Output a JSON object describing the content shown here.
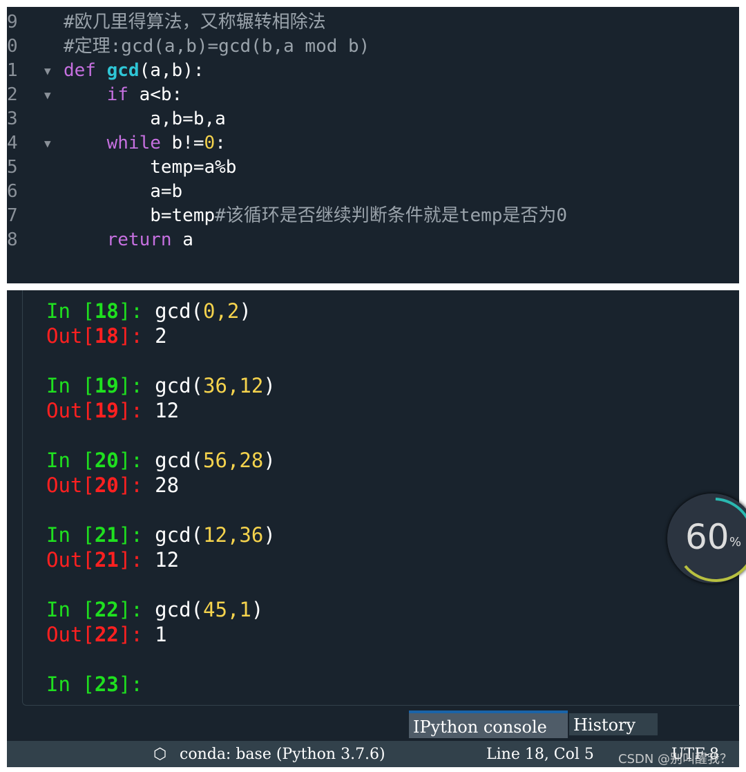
{
  "editor": {
    "lines": [
      {
        "num": "9",
        "fold": false,
        "parts": [
          {
            "t": "#欧几里得算法，又称辗转相除法",
            "c": "cm"
          }
        ]
      },
      {
        "num": "0",
        "fold": false,
        "parts": [
          {
            "t": "#定理:gcd(a,b)=gcd(b,a mod b)",
            "c": "cm"
          }
        ]
      },
      {
        "num": "1",
        "fold": true,
        "parts": [
          {
            "t": "def ",
            "c": "kw"
          },
          {
            "t": "gcd",
            "c": "fn"
          },
          {
            "t": "(a,b):",
            "c": ""
          }
        ]
      },
      {
        "num": "2",
        "fold": true,
        "parts": [
          {
            "t": "    ",
            "c": ""
          },
          {
            "t": "if",
            "c": "kw"
          },
          {
            "t": " a<b:",
            "c": ""
          }
        ]
      },
      {
        "num": "3",
        "fold": false,
        "parts": [
          {
            "t": "        a,b=b,a",
            "c": ""
          }
        ]
      },
      {
        "num": "4",
        "fold": true,
        "parts": [
          {
            "t": "    ",
            "c": ""
          },
          {
            "t": "while",
            "c": "kw"
          },
          {
            "t": " b!=",
            "c": ""
          },
          {
            "t": "0",
            "c": "num"
          },
          {
            "t": ":",
            "c": ""
          }
        ]
      },
      {
        "num": "5",
        "fold": false,
        "parts": [
          {
            "t": "        temp=a%b",
            "c": ""
          }
        ]
      },
      {
        "num": "6",
        "fold": false,
        "parts": [
          {
            "t": "        a=b",
            "c": ""
          }
        ]
      },
      {
        "num": "7",
        "fold": false,
        "parts": [
          {
            "t": "        b=temp",
            "c": ""
          },
          {
            "t": "#该循环是否继续判断条件就是temp是否为0",
            "c": "cm"
          }
        ]
      },
      {
        "num": "8",
        "fold": false,
        "parts": [
          {
            "t": "    ",
            "c": ""
          },
          {
            "t": "return",
            "c": "kw"
          },
          {
            "t": " a",
            "c": ""
          }
        ]
      }
    ]
  },
  "console": {
    "cells": [
      {
        "n": "18",
        "call": "gcd",
        "args": "0,2",
        "out": "2"
      },
      {
        "n": "19",
        "call": "gcd",
        "args": "36,12",
        "out": "12"
      },
      {
        "n": "20",
        "call": "gcd",
        "args": "56,28",
        "out": "28"
      },
      {
        "n": "21",
        "call": "gcd",
        "args": "12,36",
        "out": "12"
      },
      {
        "n": "22",
        "call": "gcd",
        "args": "45,1",
        "out": "1"
      }
    ],
    "prompt_n": "23"
  },
  "tabs": {
    "ipython": "IPython console",
    "history": "History"
  },
  "status": {
    "env": "conda: base (Python 3.7.6)",
    "position": "Line 18, Col 5",
    "encoding": "UTF-8"
  },
  "gauge": {
    "value": "60",
    "unit": "%"
  },
  "watermark": "CSDN @别叫醒我？"
}
